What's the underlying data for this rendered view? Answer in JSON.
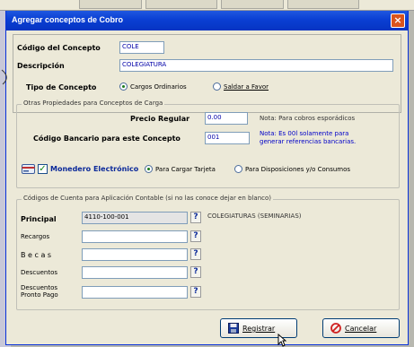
{
  "window": {
    "title": "Agregar conceptos de Cobro",
    "close_glyph": "×"
  },
  "concepto": {
    "codigo_label": "Código del Concepto",
    "codigo_value": "COLE",
    "descripcion_label": "Descripción",
    "descripcion_value": "COLEGIATURA",
    "tipo_label": "Tipo de Concepto",
    "tipo_options": [
      {
        "label": "Cargos Ordinarios",
        "selected": true
      },
      {
        "label": "Saldar a Favor",
        "selected": false
      }
    ]
  },
  "otras": {
    "legend": "Otras Propiedades para Conceptos de Carga",
    "precio_label": "Precio Regular",
    "precio_value": "0.00",
    "precio_note": "Nota: Para cobros esporádicos",
    "codigo_bancario_label": "Código Bancario para este Concepto",
    "codigo_bancario_value": "001",
    "codigo_bancario_note_1": "Nota: Es 00l solamente para",
    "codigo_bancario_note_2": "generar referencias bancarias.",
    "monedero_label": "Monedero Electrónico",
    "monedero_checked": true,
    "monedero_options": [
      {
        "label": "Para Cargar Tarjeta",
        "selected": true
      },
      {
        "label": "Para Disposiciones y/o Consumos",
        "selected": false
      }
    ]
  },
  "cuentas": {
    "legend": "Códigos de Cuenta para Aplicación Contable  (si no las conoce dejar en blanco)",
    "rows": [
      {
        "label": "Principal",
        "value": "4110-100-001",
        "bold": true
      },
      {
        "label": "Recargos",
        "value": ""
      },
      {
        "label": "B e c a s",
        "value": ""
      },
      {
        "label": "Descuentos",
        "value": ""
      },
      {
        "label": "Descuentos Pronto Pago",
        "value": ""
      }
    ],
    "principal_desc": "COLEGIATURAS (SEMINARIAS)",
    "lookup_glyph": "?"
  },
  "actions": {
    "registrar": "Registrar",
    "cancelar": "Cancelar"
  },
  "colors": {
    "titlebar": "#0a3fd3",
    "close": "#d9541d",
    "field_text": "#0000a8",
    "note_text": "#0000c8"
  }
}
